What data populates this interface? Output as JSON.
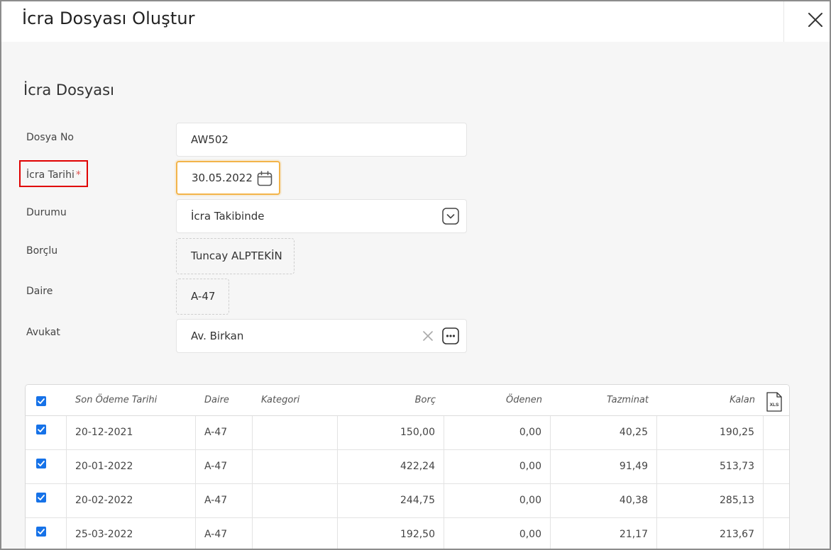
{
  "dialog": {
    "title": "İcra Dosyası Oluştur",
    "close_icon": "close-icon"
  },
  "section": {
    "title": "İcra Dosyası"
  },
  "form": {
    "dosya_no": {
      "label": "Dosya No",
      "value": "AW502"
    },
    "icra_tarihi": {
      "label": "İcra Tarihi",
      "required_mark": "*",
      "value": "30.05.2022",
      "icon": "calendar-icon"
    },
    "durumu": {
      "label": "Durumu",
      "value": "İcra Takibinde",
      "icon": "chevron-down-icon"
    },
    "borclu": {
      "label": "Borçlu",
      "value": "Tuncay ALPTEKİN"
    },
    "daire": {
      "label": "Daire",
      "value": "A-47"
    },
    "avukat": {
      "label": "Avukat",
      "value": "Av. Birkan",
      "clear_icon": "clear-x-icon",
      "more_icon": "more-dots-icon"
    }
  },
  "table": {
    "headers": {
      "son_odeme_tarihi": "Son Ödeme Tarihi",
      "daire": "Daire",
      "kategori": "Kategori",
      "borc": "Borç",
      "odenen": "Ödenen",
      "tazminat": "Tazminat",
      "kalan": "Kalan",
      "export_icon": "xls-export-icon",
      "export_label": "XLS"
    },
    "rows": [
      {
        "checked": true,
        "date": "20-12-2021",
        "daire": "A-47",
        "kategori": "",
        "borc": "150,00",
        "odenen": "0,00",
        "tazminat": "40,25",
        "kalan": "190,25"
      },
      {
        "checked": true,
        "date": "20-01-2022",
        "daire": "A-47",
        "kategori": "",
        "borc": "422,24",
        "odenen": "0,00",
        "tazminat": "91,49",
        "kalan": "513,73"
      },
      {
        "checked": true,
        "date": "20-02-2022",
        "daire": "A-47",
        "kategori": "",
        "borc": "244,75",
        "odenen": "0,00",
        "tazminat": "40,38",
        "kalan": "285,13"
      },
      {
        "checked": true,
        "date": "25-03-2022",
        "daire": "A-47",
        "kategori": "",
        "borc": "192,50",
        "odenen": "0,00",
        "tazminat": "21,17",
        "kalan": "213,67"
      }
    ]
  },
  "colors": {
    "accent_checkbox": "#1672e8",
    "focus_border": "#f3b44a",
    "required_star": "#e0524f",
    "highlight_box": "#e00000"
  }
}
